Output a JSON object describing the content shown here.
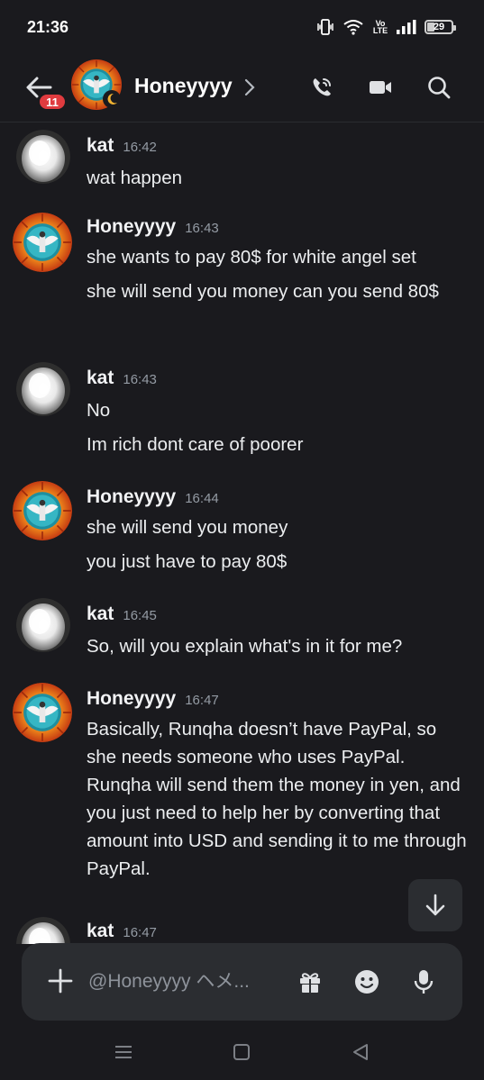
{
  "status_bar": {
    "time": "21:36",
    "battery": "29",
    "network_label": "Vo LTE"
  },
  "header": {
    "badge_count": "11",
    "channel_name": "Honeyyyy",
    "icons": [
      "back-arrow-icon",
      "phone-call-icon",
      "video-camera-icon",
      "search-icon"
    ]
  },
  "messages": [
    {
      "author": "kat",
      "time": "16:42",
      "avatar": "kat",
      "lines": [
        "wat happen"
      ]
    },
    {
      "author": "Honeyyyy",
      "time": "16:43",
      "avatar": "honey",
      "lines": [
        "she wants to pay 80$ for white angel set",
        "she will send you money can you send 80$"
      ]
    },
    {
      "author": "kat",
      "time": "16:43",
      "avatar": "kat",
      "lines": [
        "No",
        "Im rich dont care of poorer"
      ]
    },
    {
      "author": "Honeyyyy",
      "time": "16:44",
      "avatar": "honey",
      "lines": [
        "she will send you money",
        "you just have to pay 80$"
      ]
    },
    {
      "author": "kat",
      "time": "16:45",
      "avatar": "kat",
      "lines": [
        "So, will you explain what's in it for me?"
      ]
    },
    {
      "author": "Honeyyyy",
      "time": "16:47",
      "avatar": "honey",
      "lines": [
        "Basically, Runqha doesn’t have PayPal, so she needs someone who uses PayPal. Runqha will send them the money in yen, and you just need to help her by converting that amount into USD and sending it to me through PayPal."
      ]
    },
    {
      "author": "kat",
      "time": "16:47",
      "avatar": "kat",
      "lines": []
    }
  ],
  "composer": {
    "placeholder": "@Honeyyyy ヘメ...",
    "icons": [
      "plus-icon",
      "gift-icon",
      "emoji-icon",
      "microphone-icon"
    ]
  },
  "colors": {
    "background": "#1a1a1e",
    "surface": "#2b2d31",
    "badge": "#e03b3f",
    "text": "#eceef0",
    "muted": "#949ba4"
  }
}
